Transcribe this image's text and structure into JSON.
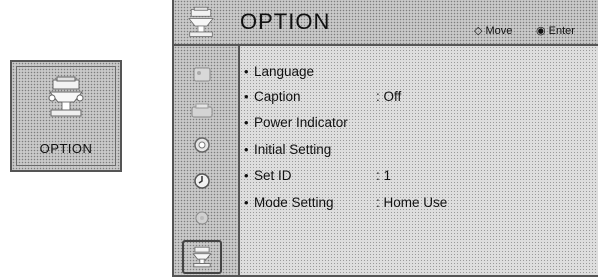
{
  "card": {
    "label": "OPTION",
    "icon": "option-icon"
  },
  "header": {
    "title": "OPTION",
    "hint_move": "Move",
    "hint_enter": "Enter",
    "move_glyph": "◇",
    "enter_glyph": "◉"
  },
  "rail": [
    {
      "icon": "picture-icon",
      "active": false
    },
    {
      "icon": "audio-icon",
      "active": false
    },
    {
      "icon": "channel-icon",
      "active": false
    },
    {
      "icon": "time-icon",
      "active": false
    },
    {
      "icon": "lock-icon",
      "active": false
    },
    {
      "icon": "option-icon",
      "active": true
    }
  ],
  "items": [
    {
      "label": "Language",
      "value": ""
    },
    {
      "label": "Caption",
      "value": ": Off"
    },
    {
      "label": "Power Indicator",
      "value": ""
    },
    {
      "label": "Initial Setting",
      "value": ""
    },
    {
      "label": "Set ID",
      "value": ": 1"
    },
    {
      "label": "Mode Setting",
      "value": ": Home Use"
    }
  ]
}
